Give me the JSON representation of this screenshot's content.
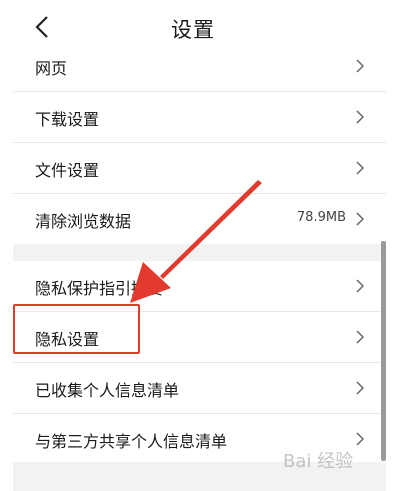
{
  "header": {
    "title": "设置"
  },
  "group1": {
    "items": [
      {
        "label": "网页",
        "value": ""
      },
      {
        "label": "下载设置",
        "value": ""
      },
      {
        "label": "文件设置",
        "value": ""
      },
      {
        "label": "清除浏览数据",
        "value": "78.9MB"
      }
    ]
  },
  "group2": {
    "items": [
      {
        "label": "隐私保护指引摘要"
      },
      {
        "label": "隐私设置"
      },
      {
        "label": "已收集个人信息清单"
      },
      {
        "label": "与第三方共享个人信息清单"
      }
    ]
  },
  "watermark": "Bai 经验",
  "colors": {
    "accent_red": "#e23a2e"
  }
}
